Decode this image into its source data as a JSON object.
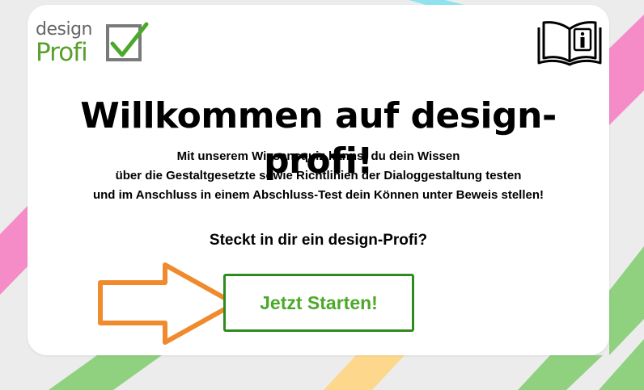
{
  "logo": {
    "line1": "design",
    "line2": "Profi"
  },
  "header": {
    "info_icon": "book-info-icon"
  },
  "main": {
    "title": "Willkommen auf design-profi!",
    "description": [
      "Mit unserem Wissensquiz kannst du dein Wissen",
      "über die Gestaltgesetzte sowie Richtlinien der Dialoggestaltung testen",
      "und im Anschluss in einem Abschluss-Test dein Können unter Beweis stellen!"
    ],
    "question": "Steckt in dir ein design-Profi?",
    "start_button": "Jetzt Starten!"
  },
  "colors": {
    "accent_green": "#4ca82a",
    "button_border": "#2f8b1f",
    "arrow_orange": "#f08a2c",
    "stripe_pink": "#f58cc8",
    "stripe_green": "#8fd17f",
    "stripe_yellow": "#fdd88c",
    "stripe_cyan": "#8fe3f0"
  }
}
